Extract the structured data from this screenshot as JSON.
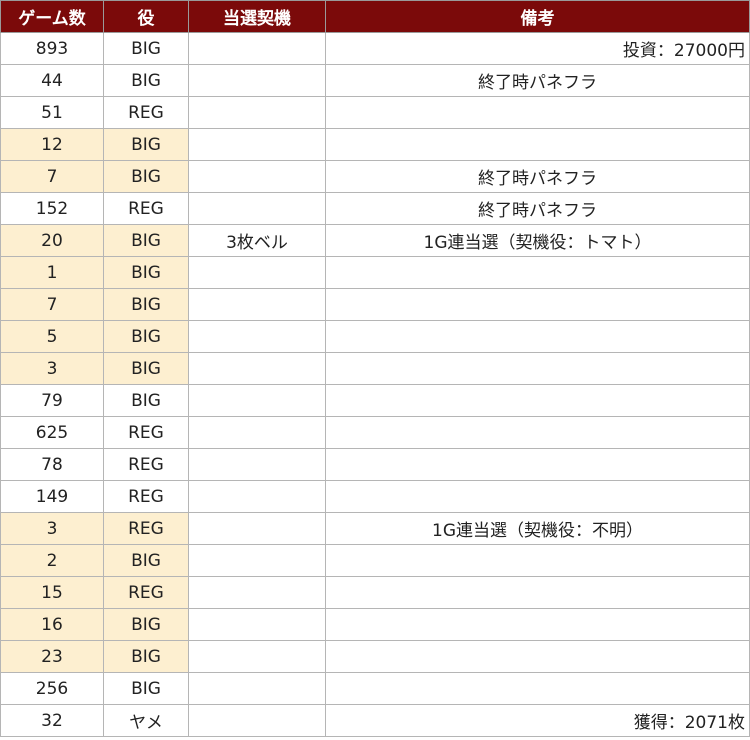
{
  "headers": {
    "games": "ゲーム数",
    "role": "役",
    "trigger": "当選契機",
    "notes": "備考"
  },
  "rows": [
    {
      "games": "893",
      "role": "BIG",
      "trigger": "",
      "note": "投資：27000円"
    },
    {
      "games": "44",
      "role": "BIG",
      "trigger": "",
      "note": "終了時パネフラ"
    },
    {
      "games": "51",
      "role": "REG",
      "trigger": "",
      "note": ""
    },
    {
      "games": "12",
      "role": "BIG",
      "trigger": "",
      "note": ""
    },
    {
      "games": "7",
      "role": "BIG",
      "trigger": "",
      "note": "終了時パネフラ"
    },
    {
      "games": "152",
      "role": "REG",
      "trigger": "",
      "note": "終了時パネフラ"
    },
    {
      "games": "20",
      "role": "BIG",
      "trigger": "3枚ベル",
      "note": "1G連当選（契機役：トマト）"
    },
    {
      "games": "1",
      "role": "BIG",
      "trigger": "",
      "note": ""
    },
    {
      "games": "7",
      "role": "BIG",
      "trigger": "",
      "note": ""
    },
    {
      "games": "5",
      "role": "BIG",
      "trigger": "",
      "note": ""
    },
    {
      "games": "3",
      "role": "BIG",
      "trigger": "",
      "note": ""
    },
    {
      "games": "79",
      "role": "BIG",
      "trigger": "",
      "note": ""
    },
    {
      "games": "625",
      "role": "REG",
      "trigger": "",
      "note": ""
    },
    {
      "games": "78",
      "role": "REG",
      "trigger": "",
      "note": ""
    },
    {
      "games": "149",
      "role": "REG",
      "trigger": "",
      "note": ""
    },
    {
      "games": "3",
      "role": "REG",
      "trigger": "",
      "note": "1G連当選（契機役：不明）"
    },
    {
      "games": "2",
      "role": "BIG",
      "trigger": "",
      "note": ""
    },
    {
      "games": "15",
      "role": "REG",
      "trigger": "",
      "note": ""
    },
    {
      "games": "16",
      "role": "BIG",
      "trigger": "",
      "note": ""
    },
    {
      "games": "23",
      "role": "BIG",
      "trigger": "",
      "note": ""
    },
    {
      "games": "256",
      "role": "BIG",
      "trigger": "",
      "note": ""
    },
    {
      "games": "32",
      "role": "ヤメ",
      "trigger": "",
      "note": "獲得：2071枚"
    }
  ],
  "colors": {
    "header_bg": "#7b0a0a",
    "highlight_bg": "#fdefd0",
    "big": "#8b1a1a",
    "reg": "#1c27e0"
  }
}
